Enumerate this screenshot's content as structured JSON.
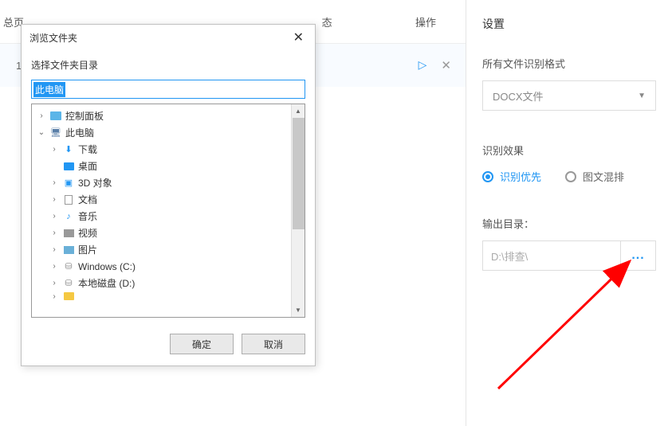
{
  "mainList": {
    "header_left_1": "总页",
    "header_operation": "操作",
    "item_index": "1",
    "status_suffix": "态"
  },
  "rightPanel": {
    "title": "设置",
    "formatLabel": "所有文件识别格式",
    "formatValue": "DOCX文件",
    "effectLabel": "识别效果",
    "radio1": "识别优先",
    "radio2": "图文混排",
    "outputLabel": "输出目录：",
    "outputPath": "D:\\排查\\",
    "browseBtn": "..."
  },
  "dialog": {
    "title": "浏览文件夹",
    "subtitle": "选择文件夹目录",
    "inputValue": "此电脑",
    "okBtn": "确定",
    "cancelBtn": "取消",
    "tree": [
      {
        "label": "控制面板",
        "indent": 0,
        "expander": "›",
        "icon": "cpanel"
      },
      {
        "label": "此电脑",
        "indent": 0,
        "expander": "⌄",
        "icon": "pc"
      },
      {
        "label": "下载",
        "indent": 1,
        "expander": "›",
        "icon": "down"
      },
      {
        "label": "桌面",
        "indent": 1,
        "expander": "",
        "icon": "desktop"
      },
      {
        "label": "3D 对象",
        "indent": 1,
        "expander": "›",
        "icon": "3d"
      },
      {
        "label": "文档",
        "indent": 1,
        "expander": "›",
        "icon": "doc"
      },
      {
        "label": "音乐",
        "indent": 1,
        "expander": "›",
        "icon": "music"
      },
      {
        "label": "视频",
        "indent": 1,
        "expander": "›",
        "icon": "video"
      },
      {
        "label": "图片",
        "indent": 1,
        "expander": "›",
        "icon": "pic"
      },
      {
        "label": "Windows (C:)",
        "indent": 1,
        "expander": "›",
        "icon": "drive"
      },
      {
        "label": "本地磁盘 (D:)",
        "indent": 1,
        "expander": "›",
        "icon": "drive"
      }
    ]
  }
}
